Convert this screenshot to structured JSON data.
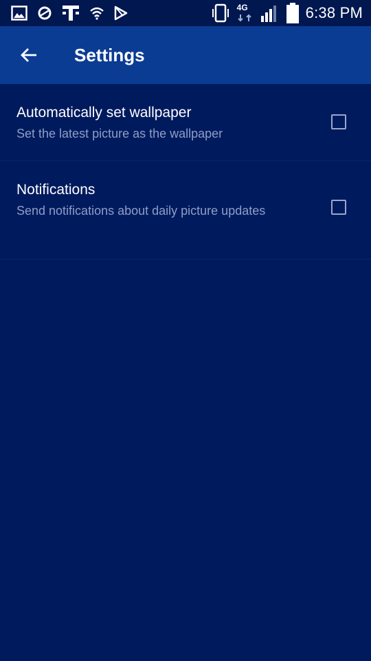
{
  "status_bar": {
    "time": "6:38 PM",
    "network_type": "4G",
    "icons_left": [
      "gallery-icon",
      "sync-icon",
      "tmobile-icon",
      "wifi-icon",
      "play-store-icon"
    ],
    "icons_right": [
      "vibrate-icon",
      "data-arrows-icon",
      "signal-icon",
      "battery-icon"
    ]
  },
  "app_bar": {
    "title": "Settings",
    "back_icon": "arrow-left-icon",
    "color": "#0b3c93"
  },
  "settings": [
    {
      "title": "Automatically set wallpaper",
      "summary": "Set the latest picture as the wallpaper",
      "checked": false
    },
    {
      "title": "Notifications",
      "summary": "Send notifications about daily picture updates",
      "checked": false
    }
  ],
  "colors": {
    "background": "#001a5e",
    "status_bar": "#00174f",
    "summary_text": "#8e9ec6"
  }
}
